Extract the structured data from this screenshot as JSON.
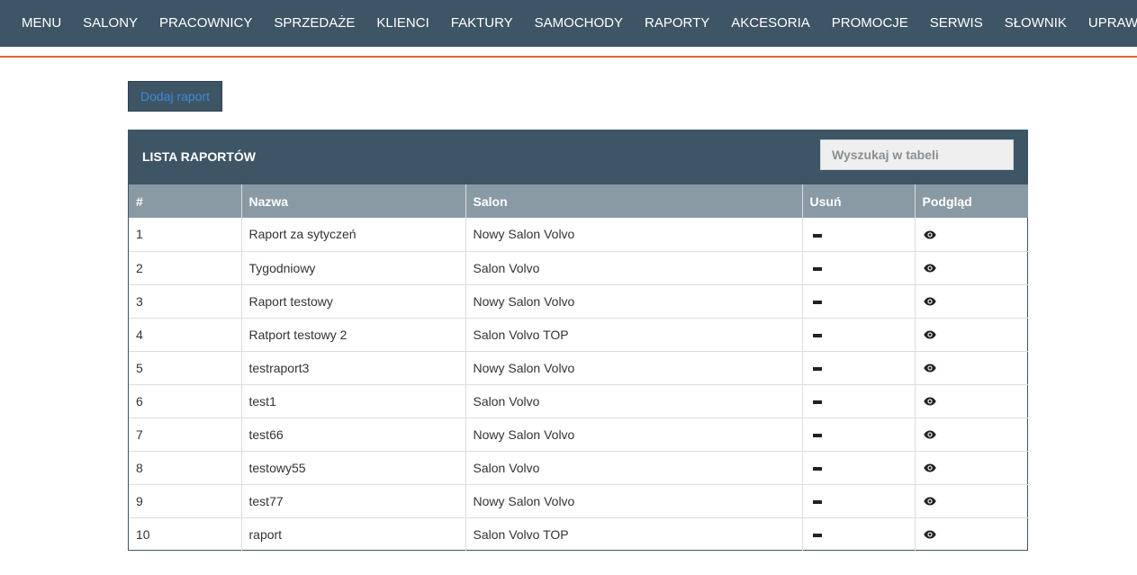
{
  "nav": {
    "items": [
      "MENU",
      "SALONY",
      "PRACOWNICY",
      "SPRZEDAŻE",
      "KLIENCI",
      "FAKTURY",
      "SAMOCHODY",
      "RAPORTY",
      "AKCESORIA",
      "PROMOCJE",
      "SERWIS",
      "SŁOWNIK",
      "UPRAWNIENIA"
    ]
  },
  "toolbar": {
    "add_label": "Dodaj raport"
  },
  "panel": {
    "title": "LISTA RAPORTÓW",
    "search_placeholder": "Wyszukaj w tabeli"
  },
  "table": {
    "headers": [
      "#",
      "Nazwa",
      "Salon",
      "Usuń",
      "Podgląd"
    ],
    "rows": [
      {
        "num": "1",
        "name": "Raport za sytyczeń",
        "salon": "Nowy Salon Volvo"
      },
      {
        "num": "2",
        "name": "Tygodniowy",
        "salon": "Salon Volvo"
      },
      {
        "num": "3",
        "name": "Raport testowy",
        "salon": "Nowy Salon Volvo"
      },
      {
        "num": "4",
        "name": "Ratport testowy 2",
        "salon": "Salon Volvo TOP"
      },
      {
        "num": "5",
        "name": "testraport3",
        "salon": "Nowy Salon Volvo"
      },
      {
        "num": "6",
        "name": "test1",
        "salon": "Salon Volvo"
      },
      {
        "num": "7",
        "name": "test66",
        "salon": "Nowy Salon Volvo"
      },
      {
        "num": "8",
        "name": "testowy55",
        "salon": "Salon Volvo"
      },
      {
        "num": "9",
        "name": "test77",
        "salon": "Nowy Salon Volvo"
      },
      {
        "num": "10",
        "name": "raport",
        "salon": "Salon Volvo TOP"
      }
    ],
    "delete_icon": "minus-icon",
    "view_icon": "eye-icon"
  },
  "colors": {
    "nav_bg": "#3e5566",
    "accent": "#e2632f",
    "table_header_bg": "#8a9aa4",
    "link": "#3d8ad6"
  }
}
